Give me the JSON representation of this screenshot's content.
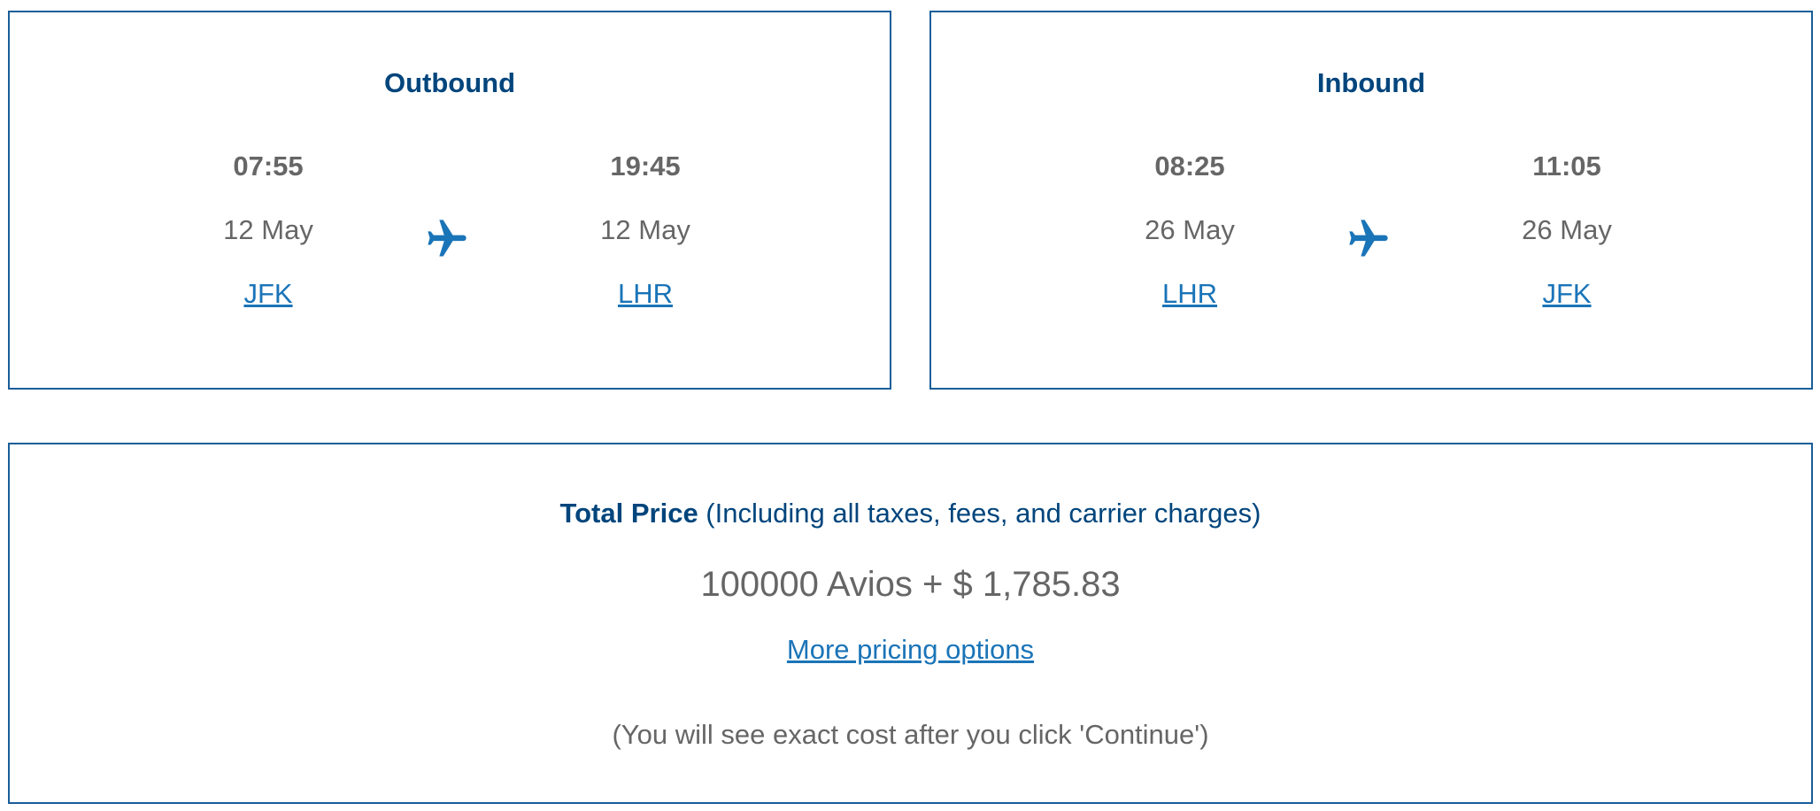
{
  "outbound": {
    "title": "Outbound",
    "depart": {
      "time": "07:55",
      "date": "12 May",
      "airport": "JFK"
    },
    "arrive": {
      "time": "19:45",
      "date": "12 May",
      "airport": "LHR"
    },
    "icon": "airplane-icon"
  },
  "inbound": {
    "title": "Inbound",
    "depart": {
      "time": "08:25",
      "date": "26 May",
      "airport": "LHR"
    },
    "arrive": {
      "time": "11:05",
      "date": "26 May",
      "airport": "JFK"
    },
    "icon": "airplane-icon"
  },
  "price": {
    "label": "Total Price",
    "label_note": " (Including all taxes, fees, and carrier charges)",
    "value": "100000 Avios + $ 1,785.83",
    "more_options": "More pricing options",
    "note": "(You will see exact cost after you click 'Continue')"
  },
  "colors": {
    "border": "#1a5e99",
    "heading": "#00457c",
    "link": "#1a74b8",
    "text": "#666666"
  }
}
